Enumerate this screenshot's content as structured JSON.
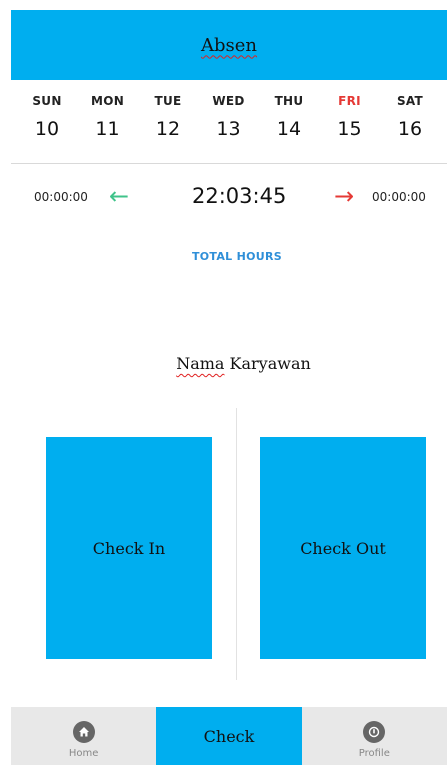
{
  "header": {
    "title": "Absen"
  },
  "week": {
    "days": [
      {
        "name": "SUN",
        "num": "10"
      },
      {
        "name": "MON",
        "num": "11"
      },
      {
        "name": "TUE",
        "num": "12"
      },
      {
        "name": "WED",
        "num": "13"
      },
      {
        "name": "THU",
        "num": "14"
      },
      {
        "name": "FRI",
        "num": "15",
        "active": true
      },
      {
        "name": "SAT",
        "num": "16"
      }
    ]
  },
  "timer": {
    "start": "00:00:00",
    "current": "22:03:45",
    "end": "00:00:00",
    "total_hours_label": "TOTAL HOURS"
  },
  "employee": {
    "name_part1": "Nama",
    "name_part2": " Karyawan"
  },
  "actions": {
    "check_in_label": "Check In",
    "check_out_label": "Check Out"
  },
  "nav": {
    "home_label": "Home",
    "check_label": "Check",
    "profile_label": "Profile"
  },
  "colors": {
    "accent": "#00aeef",
    "active_day": "#e53935",
    "arrow_left": "#3fc38a",
    "arrow_right": "#e53935",
    "total_hours": "#2f8fd8"
  }
}
